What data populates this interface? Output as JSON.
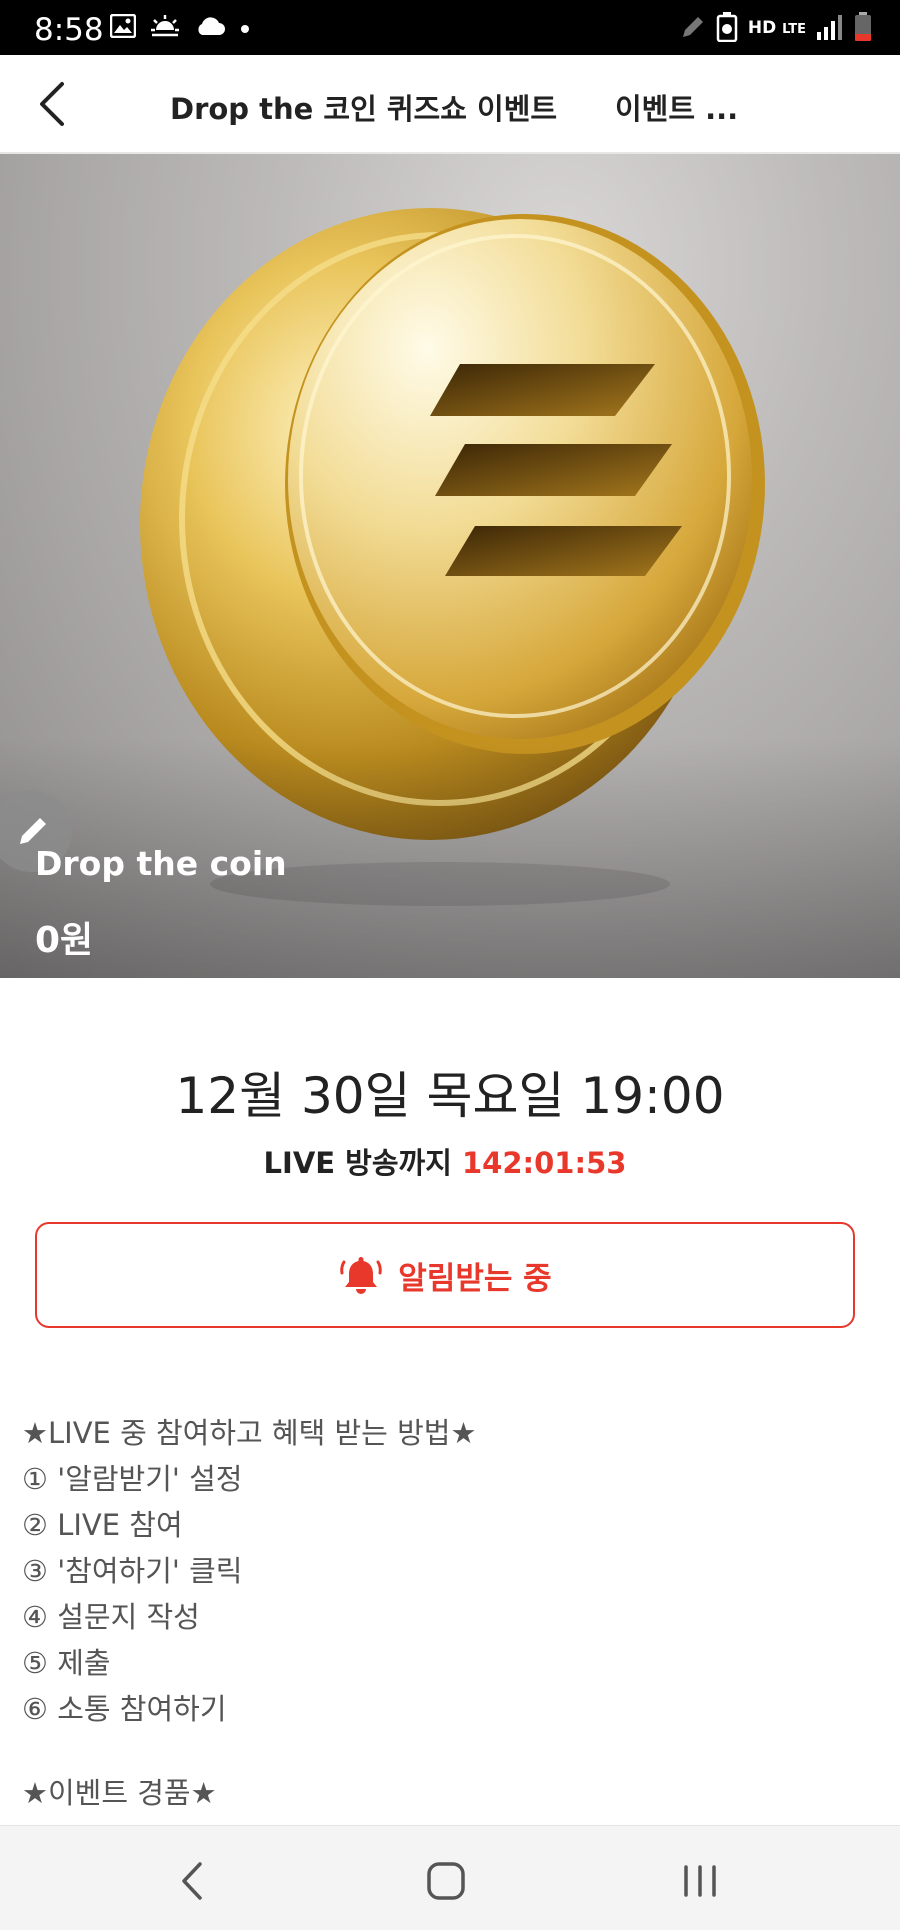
{
  "status_bar": {
    "time": "8:58",
    "left_icons": [
      "image-icon",
      "sun-icon",
      "cloud-icon",
      "dot-icon"
    ],
    "right_icons": [
      "pen-icon",
      "battery-saver-icon",
      "hd-voice-lte-icon",
      "signal-icon",
      "battery-icon"
    ],
    "network_label": "HD",
    "network_sub": "LTE"
  },
  "header": {
    "title": "Drop the 코인 퀴즈쇼 이벤트",
    "tab_label": "이벤트 ..."
  },
  "hero": {
    "product_name": "Drop the coin",
    "price": "0원"
  },
  "schedule": {
    "date_text": "12월 30일 목요일 19:00",
    "countdown_prefix": "LIVE 방송까지 ",
    "countdown_time": "142:01:53"
  },
  "notify_button": {
    "label": "알림받는 중"
  },
  "description": {
    "lines": [
      "★LIVE 중 참여하고 혜택 받는 방법★",
      "① '알람받기' 설정",
      "② LIVE 참여",
      "③ '참여하기' 클릭",
      "④ 설문지 작성",
      "⑤ 제출",
      "⑥ 소통 참여하기"
    ],
    "section2_title": "★이벤트 경품★"
  },
  "colors": {
    "accent": "#e8382c",
    "text_dark": "#222222",
    "text_gray": "#555555"
  }
}
